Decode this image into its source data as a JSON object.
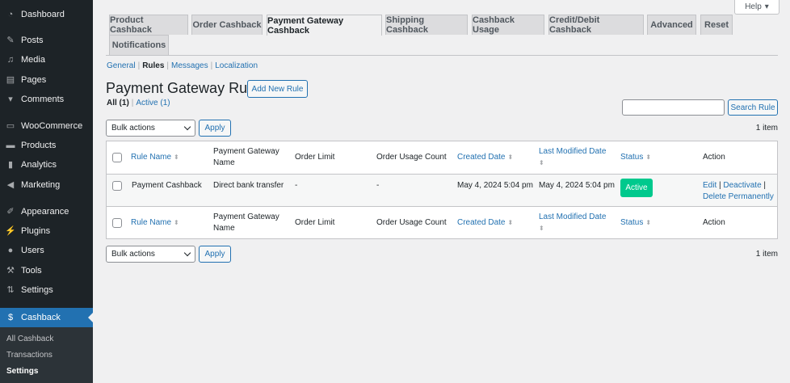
{
  "sidebar": {
    "items": [
      {
        "label": "Dashboard",
        "icon": "dashboard-icon"
      },
      {
        "label": "Posts",
        "icon": "pin-icon"
      },
      {
        "label": "Media",
        "icon": "media-icon"
      },
      {
        "label": "Pages",
        "icon": "pages-icon"
      },
      {
        "label": "Comments",
        "icon": "comment-icon"
      },
      {
        "label": "WooCommerce",
        "icon": "woo-icon"
      },
      {
        "label": "Products",
        "icon": "archive-icon"
      },
      {
        "label": "Analytics",
        "icon": "bar-chart-icon"
      },
      {
        "label": "Marketing",
        "icon": "megaphone-icon"
      },
      {
        "label": "Appearance",
        "icon": "brush-icon"
      },
      {
        "label": "Plugins",
        "icon": "plugin-icon"
      },
      {
        "label": "Users",
        "icon": "user-icon"
      },
      {
        "label": "Tools",
        "icon": "wrench-icon"
      },
      {
        "label": "Settings",
        "icon": "settings-icon"
      },
      {
        "label": "Cashback",
        "icon": "cashback-icon"
      }
    ],
    "submenu": [
      "All Cashback",
      "Transactions",
      "Settings"
    ]
  },
  "help": "Help",
  "tabs": [
    "Product Cashback",
    "Order Cashback",
    "Payment Gateway Cashback",
    "Shipping Cashback",
    "Cashback Usage",
    "Credit/Debit Cashback",
    "Advanced",
    "Reset",
    "Notifications"
  ],
  "subnav": [
    "General",
    "Rules",
    "Messages",
    "Localization"
  ],
  "title": "Payment Gateway Rules",
  "add_new": "Add New Rule",
  "views": {
    "all": "All (1)",
    "active": "Active (1)"
  },
  "search_button": "Search Rule",
  "bulk": {
    "selected": "Bulk actions",
    "apply": "Apply",
    "count": "1 item"
  },
  "columns": {
    "rule_name": "Rule Name",
    "gateway": "Payment Gateway Name",
    "order_limit": "Order Limit",
    "usage": "Order Usage Count",
    "created": "Created Date",
    "modified": "Last Modified Date",
    "status": "Status",
    "action": "Action"
  },
  "rows": [
    {
      "rule_name": "Payment Cashback",
      "gateway": "Direct bank transfer",
      "order_limit": "-",
      "usage": "-",
      "created": "May 4, 2024 5:04 pm",
      "modified": "May 4, 2024 5:04 pm",
      "status": "Active",
      "edit": "Edit",
      "deactivate": "Deactivate",
      "delete": "Delete Permanently"
    }
  ],
  "colors": {
    "accent": "#2271b1",
    "active_badge": "#00c98d",
    "sidebar": "#1d2327"
  }
}
